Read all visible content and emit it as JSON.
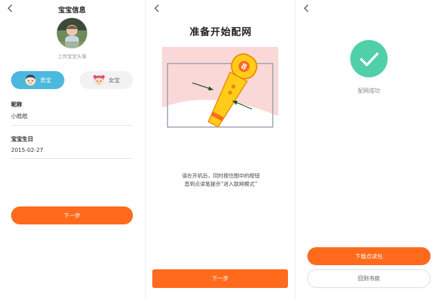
{
  "colors": {
    "accent": "#ff6a1d",
    "boy": "#4bb8dd",
    "success": "#4fd0a8"
  },
  "screen1": {
    "back_icon": "chevron-left-icon",
    "title": "宝宝信息",
    "upload_hint": "上传宝宝头像",
    "gender_boy": "男宝",
    "gender_girl": "女宝",
    "selected_gender": "男宝",
    "nickname_label": "昵称",
    "nickname_value": "小皓皓",
    "birthday_label": "宝宝生日",
    "birthday_value": "2015-02-27",
    "next_button": "下一步"
  },
  "screen2": {
    "back_icon": "chevron-left-icon",
    "title": "准备开始配网",
    "instruction_line1": "请在开机后，同时按住图中的按钮",
    "instruction_line2": "直到点读笔提示“进入联网模式”",
    "next_button": "下一步"
  },
  "screen3": {
    "back_icon": "chevron-left-icon",
    "success_icon": "checkmark-icon",
    "success_text": "配网成功",
    "download_button": "下载点读包",
    "bookshelf_button": "回到书房"
  }
}
